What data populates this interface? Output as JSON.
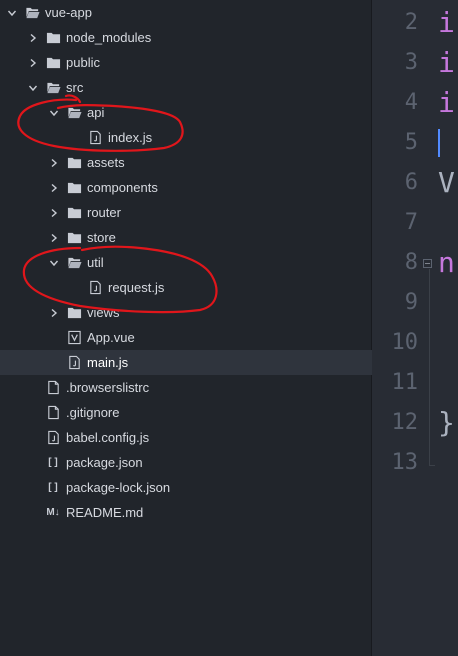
{
  "tree": [
    {
      "label": "vue-app",
      "icon": "folder-open-icon",
      "chevron": "down",
      "indent": 0
    },
    {
      "label": "node_modules",
      "icon": "folder-icon",
      "chevron": "right",
      "indent": 1
    },
    {
      "label": "public",
      "icon": "folder-icon",
      "chevron": "right",
      "indent": 1
    },
    {
      "label": "src",
      "icon": "folder-open-icon",
      "chevron": "down",
      "indent": 1
    },
    {
      "label": "api",
      "icon": "folder-open-icon",
      "chevron": "down",
      "indent": 2
    },
    {
      "label": "index.js",
      "icon": "js-file-icon",
      "chevron": "",
      "indent": 3
    },
    {
      "label": "assets",
      "icon": "folder-icon",
      "chevron": "right",
      "indent": 2
    },
    {
      "label": "components",
      "icon": "folder-icon",
      "chevron": "right",
      "indent": 2
    },
    {
      "label": "router",
      "icon": "folder-icon",
      "chevron": "right",
      "indent": 2
    },
    {
      "label": "store",
      "icon": "folder-icon",
      "chevron": "right",
      "indent": 2
    },
    {
      "label": "util",
      "icon": "folder-open-icon",
      "chevron": "down",
      "indent": 2
    },
    {
      "label": "request.js",
      "icon": "js-file-icon",
      "chevron": "",
      "indent": 3
    },
    {
      "label": "views",
      "icon": "folder-icon",
      "chevron": "right",
      "indent": 2
    },
    {
      "label": "App.vue",
      "icon": "vue-file-icon",
      "chevron": "",
      "indent": 2
    },
    {
      "label": "main.js",
      "icon": "js-file-icon",
      "chevron": "",
      "indent": 2,
      "selected": true
    },
    {
      "label": ".browserslistrc",
      "icon": "file-icon",
      "chevron": "",
      "indent": 1
    },
    {
      "label": ".gitignore",
      "icon": "file-icon",
      "chevron": "",
      "indent": 1
    },
    {
      "label": "babel.config.js",
      "icon": "js-file-icon",
      "chevron": "",
      "indent": 1
    },
    {
      "label": "package.json",
      "icon": "json-file-icon",
      "chevron": "",
      "indent": 1
    },
    {
      "label": "package-lock.json",
      "icon": "json-file-icon",
      "chevron": "",
      "indent": 1
    },
    {
      "label": "README.md",
      "icon": "markdown-file-icon",
      "chevron": "",
      "indent": 1
    }
  ],
  "icon_glyphs": {
    "json-file-icon": "[ ]",
    "markdown-file-icon": "M↓"
  },
  "editor": {
    "lines": [
      {
        "num": "2",
        "char": "i",
        "color": "#c678dd"
      },
      {
        "num": "3",
        "char": "i",
        "color": "#c678dd"
      },
      {
        "num": "4",
        "char": "i",
        "color": "#c678dd"
      },
      {
        "num": "5",
        "char": "",
        "color": "#abb2bf"
      },
      {
        "num": "6",
        "char": "V",
        "color": "#abb2bf"
      },
      {
        "num": "7",
        "char": "",
        "color": "#abb2bf"
      },
      {
        "num": "8",
        "char": "n",
        "color": "#c678dd"
      },
      {
        "num": "9",
        "char": "",
        "color": "#abb2bf"
      },
      {
        "num": "10",
        "char": "",
        "color": "#abb2bf"
      },
      {
        "num": "11",
        "char": "",
        "color": "#abb2bf"
      },
      {
        "num": "12",
        "char": "}",
        "color": "#abb2bf"
      },
      {
        "num": "13",
        "char": "",
        "color": "#abb2bf"
      }
    ]
  },
  "colors": {
    "sidebar_bg": "#21252b",
    "editor_bg": "#282c34",
    "selected_bg": "#2f343d",
    "annotation": "#e0161b",
    "keyword": "#c678dd",
    "cursor": "#528bff"
  }
}
